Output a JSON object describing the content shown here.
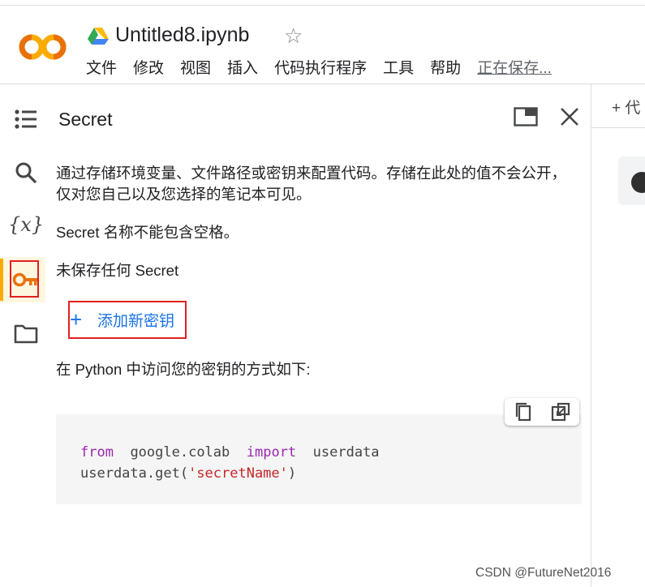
{
  "header": {
    "doc_title": "Untitled8.ipynb",
    "logo_text": "CO",
    "menu": [
      "文件",
      "修改",
      "视图",
      "插入",
      "代码执行程序",
      "工具",
      "帮助"
    ],
    "save_status": "正在保存..."
  },
  "sidebar": {
    "icons": [
      "table-of-contents-icon",
      "search-icon",
      "variables-icon",
      "key-icon",
      "folder-icon"
    ],
    "variables_glyph": "{x}",
    "active": "key-icon"
  },
  "panel": {
    "title": "Secret",
    "description": "通过存储环境变量、文件路径或密钥来配置代码。存储在此处的值不会公开，仅对您自己以及您选择的笔记本可见。",
    "name_rule": "Secret 名称不能包含空格。",
    "empty_state": "未保存任何 Secret",
    "add_button": "添加新密钥",
    "add_icon": "+",
    "access_info": "在 Python 中访问您的密钥的方式如下:",
    "code": {
      "kw_from": "from",
      "module": "google.colab",
      "kw_import": "import",
      "name": "userdata",
      "line2_prefix": "userdata.get(",
      "line2_string": "'secretName'",
      "line2_suffix": ")"
    }
  },
  "right": {
    "add_code_label": "+ 代"
  },
  "watermark": "CSDN @FutureNet2016",
  "colors": {
    "accent": "#1a73e8",
    "brand_orange": "#f9ab00",
    "highlight_box": "#e02020",
    "keyword": "#9c27b0",
    "string": "#c62828"
  }
}
